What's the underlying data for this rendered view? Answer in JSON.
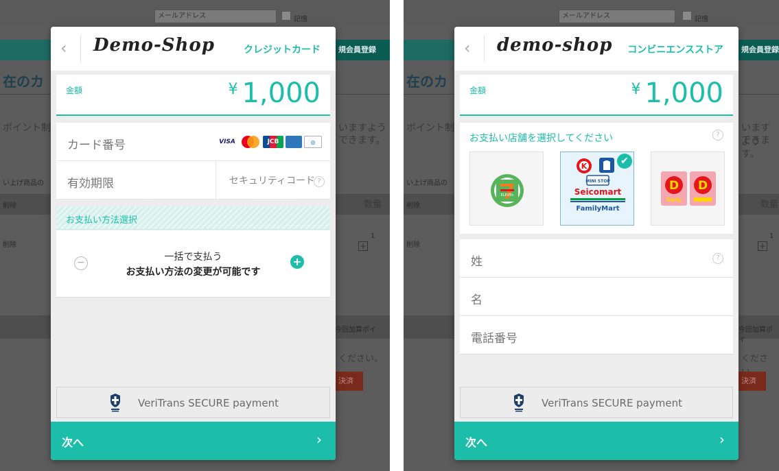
{
  "background_page": {
    "email_placeholder": "メールアドレス",
    "remember_label": "記憶",
    "register_button": "規会員登録",
    "heading_fragment": "在のカ",
    "point_text": "ポイント制",
    "notice_text_1": "いますよう",
    "notice_text_2": "できます。",
    "product_label": "い上げ商品の",
    "delete_label": "削除",
    "quantity_label": "数量",
    "quantity_value": "1",
    "points_label": "今回加算ポイ",
    "please_text": "ください。",
    "settle_button": "決済"
  },
  "credit_modal": {
    "back_label": "‹",
    "shop_logo": "Demo-Shop",
    "title": "クレジットカード",
    "amount_label": "金額",
    "currency_symbol": "¥",
    "amount_value": "1,000",
    "card_number_placeholder": "カード番号",
    "expiry_placeholder": "有効期限",
    "security_code_placeholder": "セキュリティコード",
    "help_mark": "?",
    "card_brands": [
      "VISA",
      "mastercard",
      "JCB",
      "AMEX",
      "Diners"
    ],
    "payment_method_section": "お支払い方法選択",
    "minus_label": "−",
    "plus_label": "+",
    "payment_option_line1": "一括で支払う",
    "payment_option_line2": "お支払い方法の変更が可能です",
    "secure_text": "VeriTrans SECURE payment",
    "next_button": "次へ",
    "next_arrow": "›"
  },
  "cvs_modal": {
    "back_label": "‹",
    "shop_logo": "demo-shop",
    "title": "コンビニエンスストア",
    "amount_label": "金額",
    "currency_symbol": "¥",
    "amount_value": "1,000",
    "store_hint": "お支払い店舗を選択してください",
    "help_mark": "?",
    "stores": [
      {
        "name": "7-ELEVEn",
        "selected": false
      },
      {
        "name": "Seicomart / FamilyMart / MINI STOP / LAWSON",
        "selected": true,
        "labels": [
          "Seicomart",
          "FamilyMart",
          "MINI STOP"
        ]
      },
      {
        "name": "Daily Yamazaki",
        "selected": false,
        "labels": [
          "Daily"
        ]
      }
    ],
    "selected_check": "✔",
    "last_name_placeholder": "姓",
    "first_name_placeholder": "名",
    "phone_placeholder": "電話番号",
    "secure_text": "VeriTrans SECURE payment",
    "next_button": "次へ",
    "next_arrow": "›"
  },
  "colors": {
    "accent": "#1cbeaa",
    "overlay": "#5c5c5c",
    "selected_tile": "#e8f4fc"
  }
}
